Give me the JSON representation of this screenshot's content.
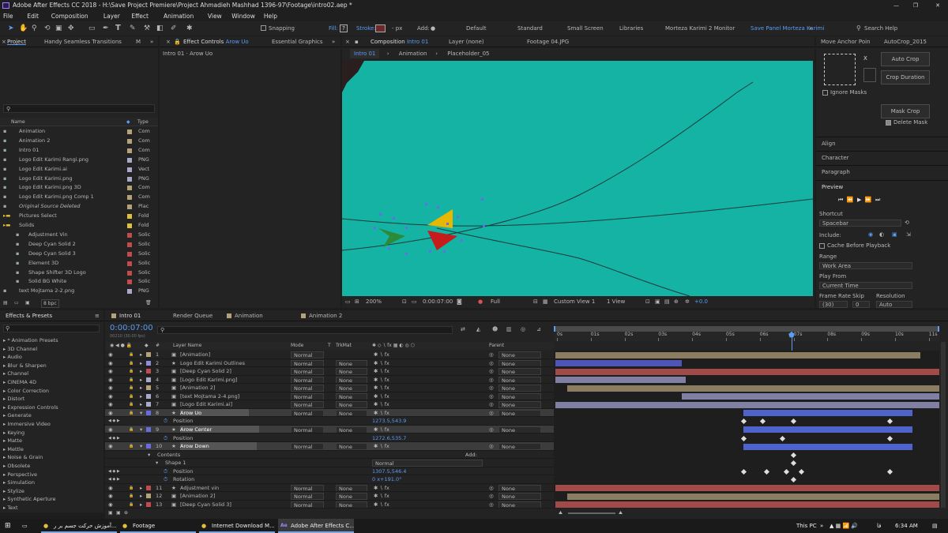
{
  "app": {
    "title": "Adobe After Effects CC 2018 - H:\\Save Project Premiere\\Project Ahmadieh Mashhad 1396-97\\Footage\\intro02.aep *"
  },
  "menu": [
    "File",
    "Edit",
    "Composition",
    "Layer",
    "Effect",
    "Animation",
    "View",
    "Window",
    "Help"
  ],
  "toolbar": {
    "snapping": "Snapping",
    "fill": "Fill:",
    "stroke": "Stroke:",
    "px": "- px",
    "add": "Add:",
    "workspaces": [
      "Default",
      "Standard",
      "Small Screen",
      "Libraries",
      "Morteza Karimi 2 Monitor",
      "Save Panel Morteza Karimi"
    ],
    "search": "Search Help"
  },
  "project": {
    "tabs": [
      "Project",
      "Handy Seamless Transitions"
    ],
    "col_name": "Name",
    "col_type": "Type",
    "bpc": "8 bpc",
    "items": [
      {
        "name": "Animation",
        "type": "Com",
        "color": "#b5a279",
        "indent": 0
      },
      {
        "name": "Animation 2",
        "type": "Com",
        "color": "#b5a279",
        "indent": 0
      },
      {
        "name": "Intro 01",
        "type": "Com",
        "color": "#b5a279",
        "indent": 0
      },
      {
        "name": "Logo Edit Karimi Rangi.png",
        "type": "PNG",
        "color": "#a9a9c9",
        "indent": 0
      },
      {
        "name": "Logo Edit Karimi.ai",
        "type": "Vect",
        "color": "#a9a9c9",
        "indent": 0
      },
      {
        "name": "Logo Edit Karimi.png",
        "type": "PNG",
        "color": "#a9a9c9",
        "indent": 0
      },
      {
        "name": "Logo Edit Karimi.png 3D",
        "type": "Com",
        "color": "#b5a279",
        "indent": 0
      },
      {
        "name": "Logo Edit Karimi.png Comp 1",
        "type": "Com",
        "color": "#b5a279",
        "indent": 0
      },
      {
        "name": "Original Source Deleted",
        "type": "Plac",
        "color": "#b5a279",
        "indent": 0
      },
      {
        "name": "Pictures Select",
        "type": "Fold",
        "color": "#e0c03c",
        "indent": 0
      },
      {
        "name": "Solids",
        "type": "Fold",
        "color": "#e0c03c",
        "indent": 0
      },
      {
        "name": "Adjustment Vin",
        "type": "Solic",
        "color": "#c44b4b",
        "indent": 1
      },
      {
        "name": "Deep Cyan Solid 2",
        "type": "Solic",
        "color": "#c44b4b",
        "indent": 1
      },
      {
        "name": "Deep Cyan Solid 3",
        "type": "Solic",
        "color": "#c44b4b",
        "indent": 1
      },
      {
        "name": "Element 3D",
        "type": "Solic",
        "color": "#c44b4b",
        "indent": 1
      },
      {
        "name": "Shape Shifter 3D Logo",
        "type": "Solic",
        "color": "#c44b4b",
        "indent": 1
      },
      {
        "name": "Solid BG White",
        "type": "Solic",
        "color": "#c44b4b",
        "indent": 1
      },
      {
        "name": "text Mojtama 2-2.png",
        "type": "PNG",
        "color": "#a9a9c9",
        "indent": 0
      }
    ]
  },
  "effect_controls": {
    "tab": "Effect Controls",
    "tab_target": "Arow Uo",
    "tab2": "Essential Graphics",
    "header": "Intro 01 · Arow Uo"
  },
  "composition": {
    "tab": "Composition",
    "tab_comp": "Intro 01",
    "layer_tab": "Layer (none)",
    "footage_tab": "Footage 04.JPG",
    "breadcrumbs": [
      "Intro 01",
      "Animation",
      "Placeholder_05"
    ],
    "zoom": "200%",
    "time": "0:00:07:00",
    "resolution": "Full",
    "view": "Custom View 1",
    "views": "1 View",
    "exposure": "+0.0"
  },
  "right_panel": {
    "move_anchor": "Move Anchor Poin",
    "autocrop": "AutoCrop_2015",
    "auto_crop": "Auto Crop",
    "crop_duration": "Crop Duration",
    "ignore_masks": "Ignore Masks",
    "mask_crop": "Mask Crop",
    "delete_mask": "Delete Mask",
    "sections": [
      "Align",
      "Character",
      "Paragraph"
    ],
    "preview": "Preview",
    "shortcut_label": "Shortcut",
    "shortcut": "Spacebar",
    "include": "Include:",
    "cache": "Cache Before Playback",
    "range_label": "Range",
    "range": "Work Area",
    "play_from_label": "Play From",
    "play_from": "Current Time",
    "frame_rate": "Frame Rate",
    "skip": "Skip",
    "resolution": "Resolution",
    "fr_val": "(30)",
    "skip_val": "0",
    "res_val": "Auto"
  },
  "effects": {
    "title": "Effects & Presets",
    "items": [
      "* Animation Presets",
      "3D Channel",
      "Audio",
      "Blur & Sharpen",
      "Channel",
      "CINEMA 4D",
      "Color Correction",
      "Distort",
      "Expression Controls",
      "Generate",
      "Immersive Video",
      "Keying",
      "Matte",
      "Mettle",
      "Noise & Grain",
      "Obsolete",
      "Perspective",
      "Simulation",
      "Stylize",
      "Synthetic Aperture",
      "Text"
    ]
  },
  "timeline": {
    "tabs": [
      "Intro 01",
      "Render Queue",
      "Animation",
      "Animation 2"
    ],
    "timecode": "0:00:07:00",
    "frames": "00210 (30.00 fps)",
    "cols": {
      "num": "#",
      "name": "Layer Name",
      "mode": "Mode",
      "t": "T",
      "trkmat": "TrkMat",
      "parent": "Parent"
    },
    "ruler": [
      "0s",
      "01s",
      "02s",
      "03s",
      "04s",
      "05s",
      "06s",
      "07s",
      "08s",
      "09s",
      "10s",
      "11s"
    ],
    "rows": [
      {
        "kind": "layer",
        "num": "1",
        "name": "[Animation]",
        "color": "#b5a279",
        "mode": "Normal",
        "trk": "",
        "parent": "None",
        "sel": false
      },
      {
        "kind": "layer",
        "num": "2",
        "name": "Logo Edit Karimi Outlines",
        "color": "#8e8ee0",
        "mode": "Normal",
        "trk": "None",
        "parent": "None",
        "sel": false
      },
      {
        "kind": "layer",
        "num": "3",
        "name": "[Deep Cyan Solid 2]",
        "color": "#c44b4b",
        "mode": "Normal",
        "trk": "None",
        "parent": "None",
        "sel": false
      },
      {
        "kind": "layer",
        "num": "4",
        "name": "[Logo Edit Karimi.png]",
        "color": "#a9a9c9",
        "mode": "Normal",
        "trk": "None",
        "parent": "None",
        "sel": false
      },
      {
        "kind": "layer",
        "num": "5",
        "name": "[Animation 2]",
        "color": "#b5a279",
        "mode": "Normal",
        "trk": "None",
        "parent": "None",
        "sel": false
      },
      {
        "kind": "layer",
        "num": "6",
        "name": "[text Mojtama 2-4.png]",
        "color": "#a9a9c9",
        "mode": "Normal",
        "trk": "None",
        "parent": "None",
        "sel": false
      },
      {
        "kind": "layer",
        "num": "7",
        "name": "[Logo Edit Karimi.ai]",
        "color": "#a9a9c9",
        "mode": "Normal",
        "trk": "None",
        "parent": "None",
        "sel": false
      },
      {
        "kind": "layer",
        "num": "8",
        "name": "Arow Uo",
        "color": "#6b6be0",
        "mode": "Normal",
        "trk": "None",
        "parent": "None",
        "sel": true
      },
      {
        "kind": "prop",
        "name": "Position",
        "value": "1273.5,543.9"
      },
      {
        "kind": "layer",
        "num": "9",
        "name": "Arow Center",
        "color": "#6b6be0",
        "mode": "Normal",
        "trk": "None",
        "parent": "None",
        "sel": true
      },
      {
        "kind": "prop",
        "name": "Position",
        "value": "1272.6,535.7"
      },
      {
        "kind": "layer",
        "num": "10",
        "name": "Arow Down",
        "color": "#6b6be0",
        "mode": "Normal",
        "trk": "None",
        "parent": "None",
        "sel": true
      },
      {
        "kind": "group",
        "name": "Contents",
        "value": "Add:"
      },
      {
        "kind": "group2",
        "name": "Shape 1",
        "value": "Normal"
      },
      {
        "kind": "prop",
        "name": "Position",
        "value": "1307.5,546.4"
      },
      {
        "kind": "prop",
        "name": "Rotation",
        "value": "0 x+191.0°"
      },
      {
        "kind": "layer",
        "num": "11",
        "name": "Adjustment vin",
        "color": "#c44b4b",
        "mode": "Normal",
        "trk": "None",
        "parent": "None",
        "sel": false
      },
      {
        "kind": "layer",
        "num": "12",
        "name": "[Animation 2]",
        "color": "#b5a279",
        "mode": "Normal",
        "trk": "None",
        "parent": "None",
        "sel": false
      },
      {
        "kind": "layer",
        "num": "13",
        "name": "[Deep Cyan Solid 3]",
        "color": "#c44b4b",
        "mode": "Normal",
        "trk": "None",
        "parent": "None",
        "sel": false
      }
    ]
  },
  "taskbar": {
    "apps": [
      "آموزش حرکت جسم بر ر...",
      "Footage",
      "Internet Download M...",
      "Adobe After Effects C..."
    ],
    "this_pc": "This PC",
    "lang": "فا",
    "clock": "6:34 AM"
  },
  "colors": {
    "comp_bg": "#14b3a4",
    "accent": "#5b9cf5"
  }
}
